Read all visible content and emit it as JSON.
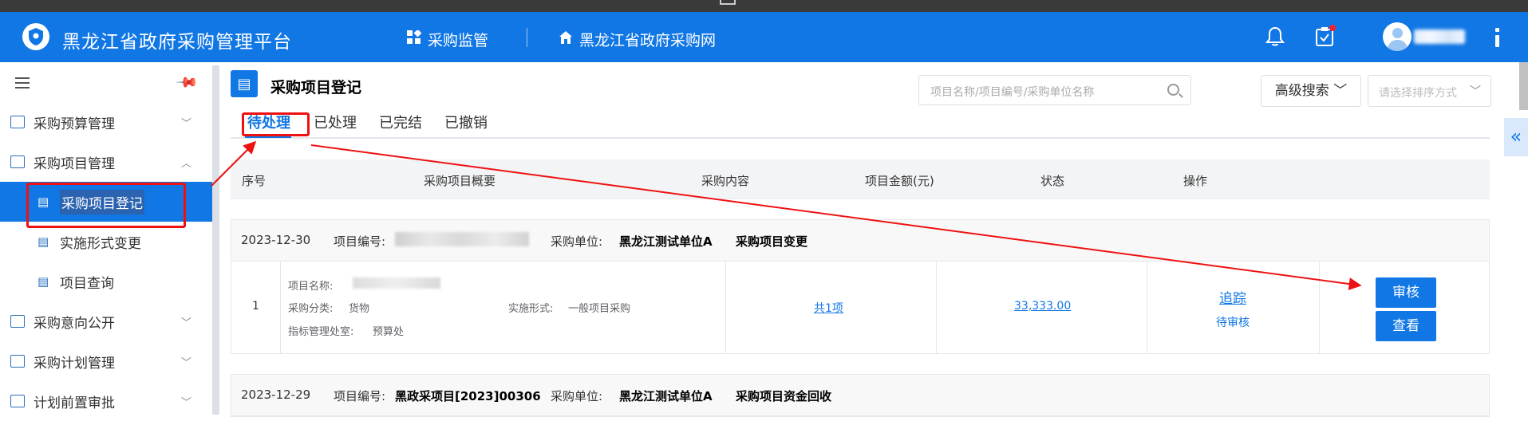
{
  "header": {
    "app_title": "黑龙江省政府采购管理平台",
    "nav": [
      {
        "label": "采购监管",
        "icon": "grid-icon"
      },
      {
        "label": "黑龙江省政府采购网",
        "icon": "home-icon"
      }
    ]
  },
  "sidebar": {
    "items": [
      {
        "label": "采购预算管理",
        "icon": "chart-icon",
        "expanded": false
      },
      {
        "label": "采购项目管理",
        "icon": "project-icon",
        "expanded": true
      },
      {
        "label": "采购意向公开",
        "icon": "gear-icon",
        "expanded": false
      },
      {
        "label": "采购计划管理",
        "icon": "calendar-icon",
        "expanded": false
      },
      {
        "label": "计划前置审批",
        "icon": "stamp-icon",
        "expanded": false
      }
    ],
    "subitems": [
      {
        "label": "采购项目登记",
        "active": true
      },
      {
        "label": "实施形式变更",
        "active": false
      },
      {
        "label": "项目查询",
        "active": false
      }
    ]
  },
  "page": {
    "title": "采购项目登记",
    "search_placeholder": "项目名称/项目编号/采购单位名称",
    "advanced_search": "高级搜索",
    "sort_placeholder": "请选择排序方式"
  },
  "tabs": [
    "待处理",
    "已处理",
    "已完结",
    "已撤销"
  ],
  "table": {
    "headers": [
      "序号",
      "采购项目概要",
      "采购内容",
      "项目金额(元)",
      "状态",
      "操作"
    ],
    "groups": [
      {
        "date": "2023-12-30",
        "project_no_label": "项目编号:",
        "project_no": "",
        "unit_label": "采购单位:",
        "unit": "黑龙江测试单位A",
        "change_type": "采购项目变更",
        "rows": [
          {
            "index": "1",
            "name_label": "项目名称:",
            "name": "",
            "category_label": "采购分类:",
            "category": "货物",
            "form_label": "实施形式:",
            "form": "一般项目采购",
            "dept_label": "指标管理处室:",
            "dept": "预算处",
            "content": "共1项",
            "amount": "33,333.00",
            "track": "追踪",
            "status": "待审核",
            "actions": [
              "审核",
              "查看"
            ]
          }
        ]
      },
      {
        "date": "2023-12-29",
        "project_no_label": "项目编号:",
        "project_no": "黑政采项目[2023]00306",
        "unit_label": "采购单位:",
        "unit": "黑龙江测试单位A",
        "change_type": "采购项目资金回收"
      }
    ]
  },
  "colors": {
    "primary": "#1177e5",
    "annotation": "#ee1111"
  }
}
